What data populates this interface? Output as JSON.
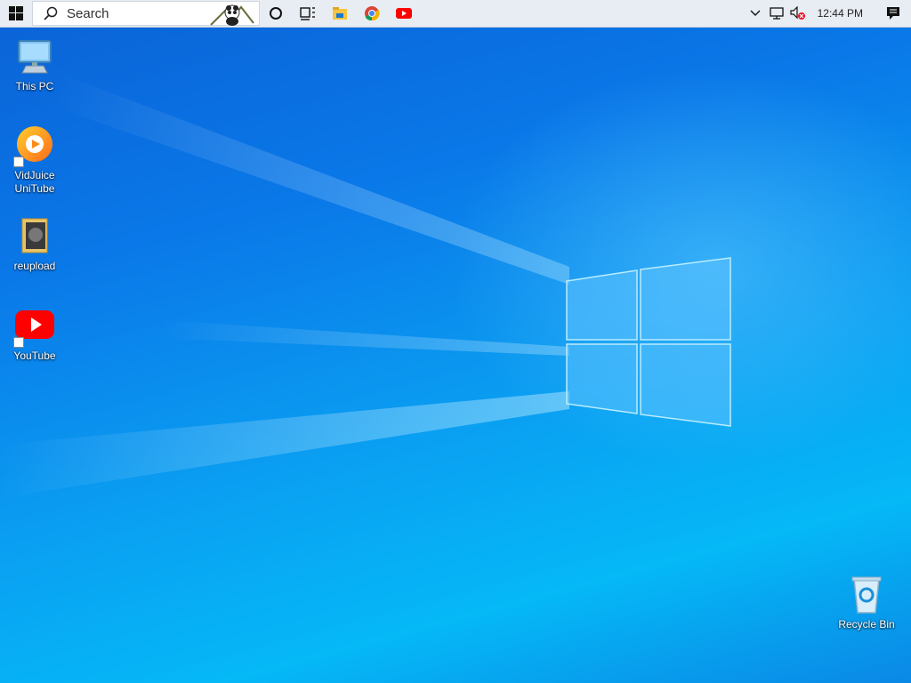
{
  "taskbar": {
    "search_placeholder": "Search",
    "pinned": [
      {
        "name": "cortana-icon"
      },
      {
        "name": "task-view-icon"
      },
      {
        "name": "file-explorer-icon"
      },
      {
        "name": "chrome-icon"
      },
      {
        "name": "youtube-icon"
      }
    ],
    "tray": {
      "clock": "12:44 PM"
    }
  },
  "desktop": {
    "icons": [
      {
        "label": "This PC",
        "icon": "monitor-icon"
      },
      {
        "label": "VidJuice UniTube",
        "icon": "vidjuice-icon"
      },
      {
        "label": "reupload",
        "icon": "folder-icon"
      },
      {
        "label": "YouTube",
        "icon": "youtube-icon"
      },
      {
        "label": "Recycle Bin",
        "icon": "recycle-bin-icon"
      }
    ]
  },
  "colors": {
    "accent": "#0078d7",
    "youtube_red": "#ff0000",
    "taskbar_bg": "#e8edf3"
  }
}
